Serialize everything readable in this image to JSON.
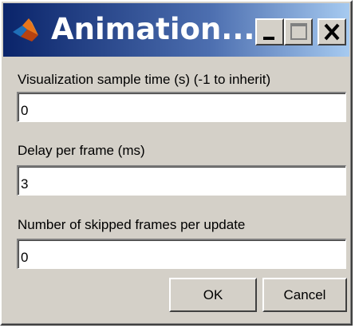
{
  "window": {
    "title": "Animation...",
    "icon": "matlab-membrane-icon",
    "title_gradient": [
      "#0a246a",
      "#a6caf0"
    ]
  },
  "titlebar_buttons": {
    "minimize_icon": "minimize-icon",
    "maximize_icon": "maximize-icon",
    "close_icon": "close-icon"
  },
  "fields": [
    {
      "label": "Visualization sample time (s) (-1 to inherit)",
      "value": "0"
    },
    {
      "label": "Delay per frame (ms)",
      "value": "3"
    },
    {
      "label": "Number of skipped frames per update",
      "value": "0"
    }
  ],
  "buttons": {
    "ok": "OK",
    "cancel": "Cancel"
  }
}
